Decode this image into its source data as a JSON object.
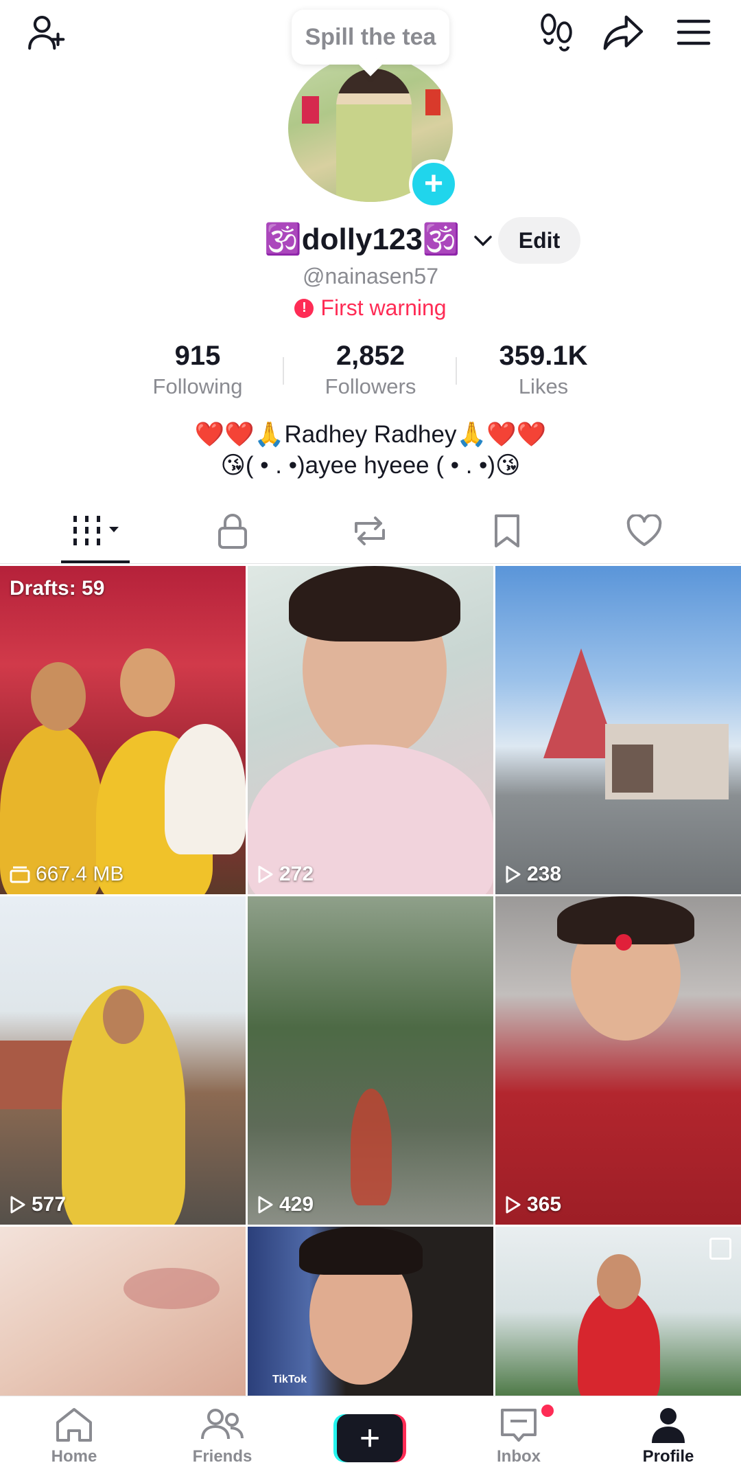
{
  "header": {
    "bubble_text": "Spill the tea",
    "icons": [
      "add-friend-icon",
      "footprints-icon",
      "share-icon",
      "menu-icon"
    ]
  },
  "profile": {
    "display_name": "🕉️dolly123🕉️",
    "handle": "@nainasen57",
    "warning": "First warning",
    "edit_label": "Edit"
  },
  "stats": [
    {
      "value": "915",
      "label": "Following"
    },
    {
      "value": "2,852",
      "label": "Followers"
    },
    {
      "value": "359.1K",
      "label": "Likes"
    }
  ],
  "bio": {
    "line1": "❤️❤️🙏Radhey Radhey🙏❤️❤️",
    "line2": "😘( • . •)ayee hyeee ( • . •)😘"
  },
  "tabs": [
    "videos-grid-icon",
    "private-lock-icon",
    "reposts-icon",
    "favorites-bookmark-icon",
    "liked-heart-icon"
  ],
  "grid": {
    "drafts_label": "Drafts: 59",
    "tiles": [
      {
        "label": "667.4 MB",
        "icon": "drafts-folder-icon"
      },
      {
        "label": "272",
        "icon": "play-icon"
      },
      {
        "label": "238",
        "icon": "play-icon"
      },
      {
        "label": "577",
        "icon": "play-icon"
      },
      {
        "label": "429",
        "icon": "play-icon"
      },
      {
        "label": "365",
        "icon": "play-icon"
      },
      {
        "label": "",
        "icon": ""
      },
      {
        "label": "",
        "icon": ""
      },
      {
        "label": "",
        "icon": ""
      }
    ],
    "watermark": "TikTok"
  },
  "nav": {
    "home": "Home",
    "friends": "Friends",
    "inbox": "Inbox",
    "profile": "Profile"
  },
  "colors": {
    "accent_red": "#fe2c55",
    "accent_cyan": "#25f4ee",
    "badge_cyan": "#20d5ec",
    "text_primary": "#161823",
    "text_secondary": "#8a8b91"
  }
}
